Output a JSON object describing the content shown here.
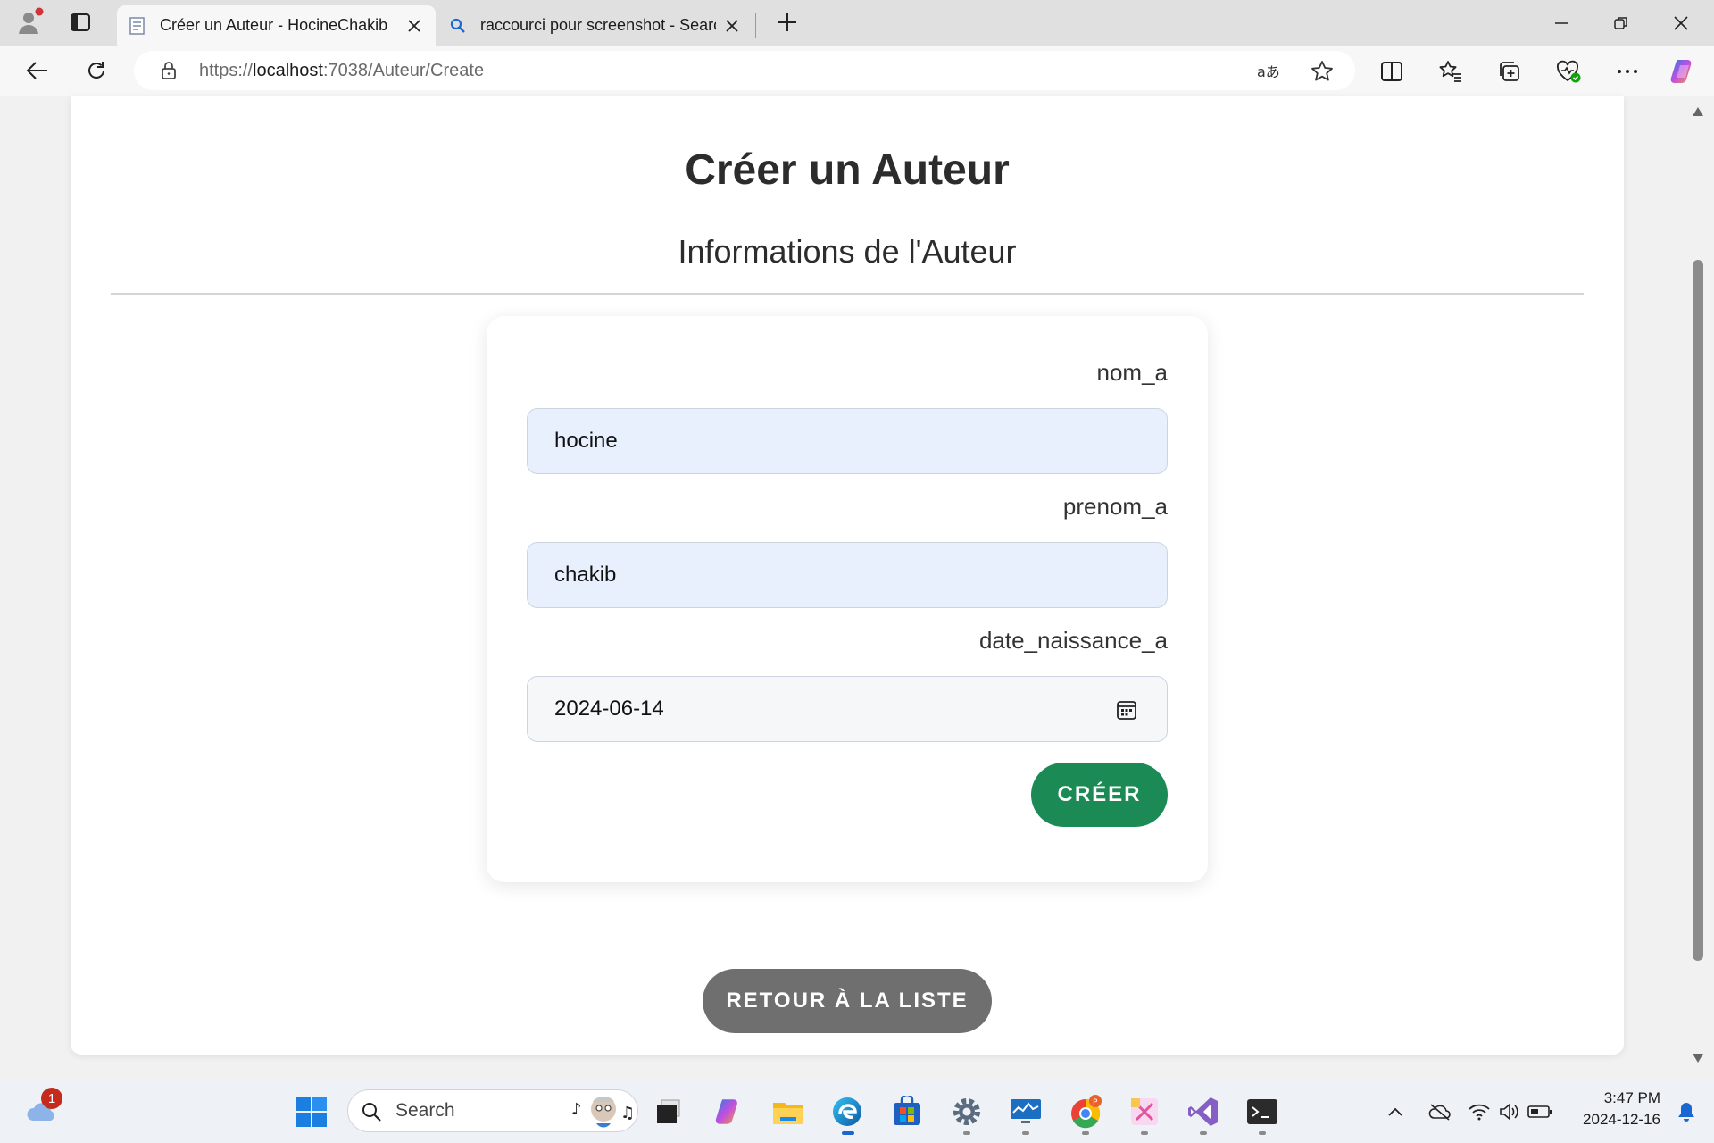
{
  "browser": {
    "tabs": [
      {
        "title": "Créer un Auteur - HocineChakib",
        "active": true
      },
      {
        "title": "raccourci pour screenshot - Search",
        "active": false
      }
    ],
    "url": {
      "scheme": "https://",
      "host": "localhost",
      "rest": ":7038/Auteur/Create"
    },
    "icons": [
      "profile-icon",
      "tab-actions-icon",
      "new-tab-icon",
      "back-icon",
      "reload-icon",
      "lock-icon",
      "read-aloud-icon",
      "favorite-star-icon",
      "split-screen-icon",
      "favorites-icon",
      "collections-icon",
      "browser-essentials-icon",
      "more-icon",
      "copilot-icon"
    ]
  },
  "page": {
    "title": "Créer un Auteur",
    "subtitle": "Informations de l'Auteur",
    "form": {
      "nom_label": "nom_a",
      "nom_value": "hocine",
      "prenom_label": "prenom_a",
      "prenom_value": "chakib",
      "date_label": "date_naissance_a",
      "date_value": "2024-06-14",
      "submit_label": "CRÉER"
    },
    "back_label": "RETOUR À LA LISTE"
  },
  "colors": {
    "create_button": "#1b8a55",
    "back_button": "#6f6f6f",
    "input_autofill": "#e8f0fe"
  },
  "taskbar": {
    "weather_badge": "1",
    "search_placeholder": "Search",
    "apps": [
      "start-icon",
      "search-icon",
      "task-view-icon",
      "copilot-icon",
      "file-explorer-icon",
      "edge-icon",
      "store-icon",
      "settings-icon",
      "monitor-icon",
      "chrome-icon",
      "snipping-icon",
      "visual-studio-icon",
      "terminal-icon"
    ],
    "clock_time": "3:47 PM",
    "clock_date": "2024-12-16"
  }
}
